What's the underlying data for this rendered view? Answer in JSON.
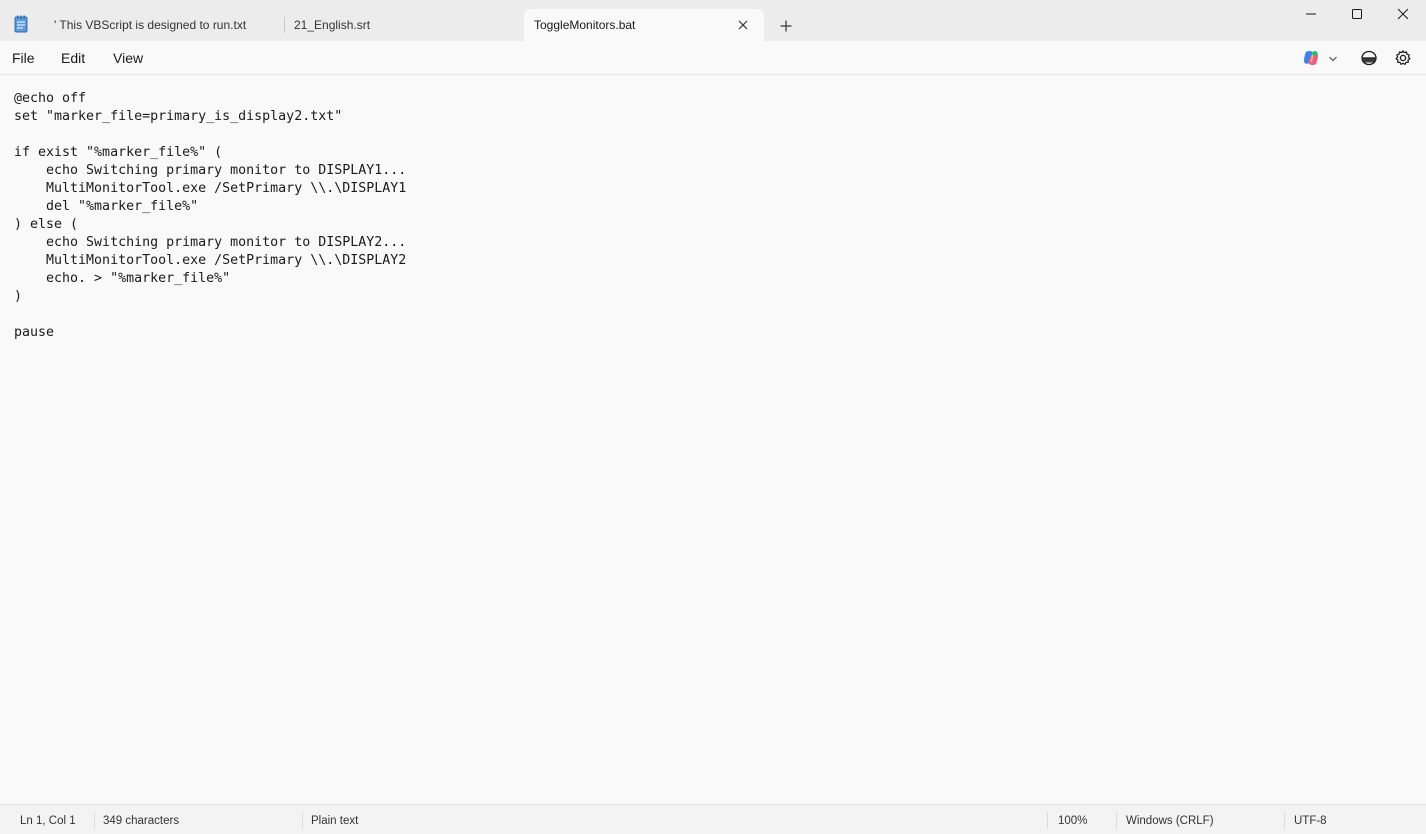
{
  "tabs": [
    {
      "label": "' This VBScript is designed to run.txt"
    },
    {
      "label": "21_English.srt"
    },
    {
      "label": "ToggleMonitors.bat",
      "active": true
    }
  ],
  "menu": {
    "file": "File",
    "edit": "Edit",
    "view": "View"
  },
  "editor": {
    "content": "@echo off\nset \"marker_file=primary_is_display2.txt\"\n\nif exist \"%marker_file%\" (\n    echo Switching primary monitor to DISPLAY1...\n    MultiMonitorTool.exe /SetPrimary \\\\.\\DISPLAY1\n    del \"%marker_file%\"\n) else (\n    echo Switching primary monitor to DISPLAY2...\n    MultiMonitorTool.exe /SetPrimary \\\\.\\DISPLAY2\n    echo. > \"%marker_file%\"\n)\n\npause"
  },
  "status": {
    "position": "Ln 1, Col 1",
    "characters": "349 characters",
    "format": "Plain text",
    "zoom": "100%",
    "line_ending": "Windows (CRLF)",
    "encoding": "UTF-8"
  },
  "icons": {
    "app": "notepad-icon",
    "tab_close": "close-icon",
    "new_tab": "plus-icon",
    "copilot": "copilot-icon",
    "spellcheck": "spellcheck-icon",
    "settings": "gear-icon"
  },
  "colors": {
    "titlebar": "#ececec",
    "editor_bg": "#f9f9f9",
    "app_icon": "#3a7bd5"
  }
}
